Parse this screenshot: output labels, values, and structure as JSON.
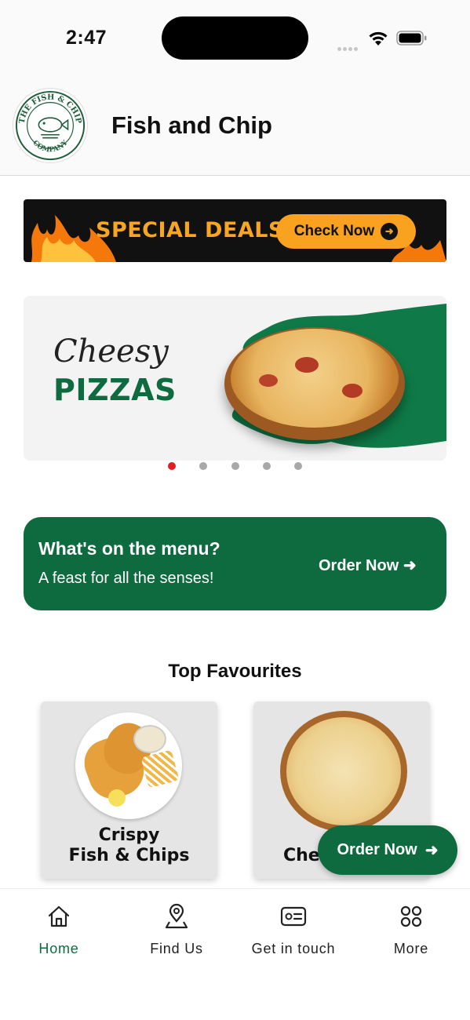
{
  "status_bar": {
    "time": "2:47",
    "icons": [
      "cellular-dots-icon",
      "wifi-icon",
      "battery-icon"
    ]
  },
  "header": {
    "logo_text_top": "THE FISH & CHIP",
    "logo_text_bottom": "COMPANY",
    "title": "Fish and Chip"
  },
  "deals_banner": {
    "title": "SPECIAL DEALS",
    "button_label": "Check Now"
  },
  "carousel": {
    "slide_script_text": "Cheesy",
    "slide_title": "PIZZAS",
    "total_slides": 5,
    "active_index": 0
  },
  "menu_card": {
    "title": "What's on the menu?",
    "subtitle": "A feast for all the senses!",
    "action_label": "Order Now"
  },
  "favourites": {
    "title": "Top Favourites",
    "items": [
      {
        "line1": "Crispy",
        "line2": "Fish & Chips"
      },
      {
        "line1": "Chee",
        "line2": ""
      }
    ]
  },
  "floating_button": {
    "label": "Order Now"
  },
  "tab_bar": {
    "tabs": [
      {
        "label": "Home",
        "icon": "home-icon",
        "active": true
      },
      {
        "label": "Find Us",
        "icon": "location-pin-icon",
        "active": false
      },
      {
        "label": "Get in touch",
        "icon": "contact-card-icon",
        "active": false
      },
      {
        "label": "More",
        "icon": "grid-dots-icon",
        "active": false
      }
    ]
  },
  "colors": {
    "brand_green": "#0e6a3f",
    "deal_orange": "#f8a21f",
    "active_dot": "#e02020"
  }
}
